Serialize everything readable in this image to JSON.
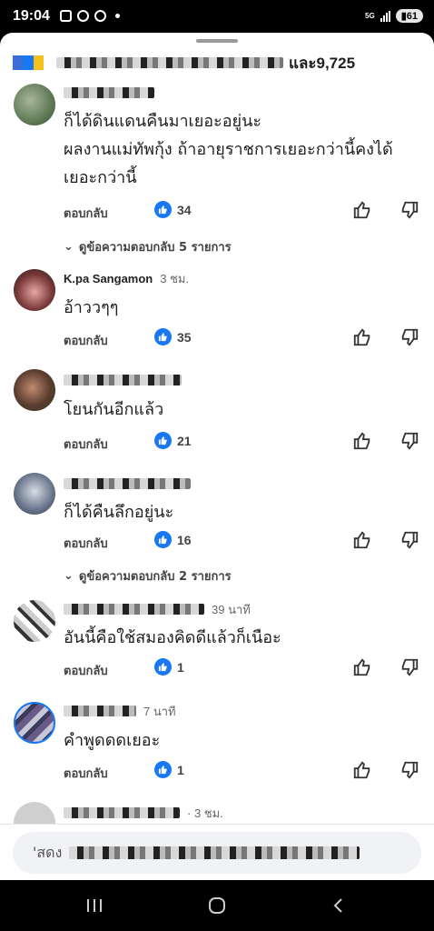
{
  "status": {
    "time": "19:04",
    "network": "5G",
    "battery": "61"
  },
  "reactions": {
    "summary_suffix": "และ9,725"
  },
  "labels": {
    "reply": "ตอบกลับ"
  },
  "comments": [
    {
      "time": "",
      "text": "ก็ได้ดินแดนคืนมาเยอะอยู่นะ\nผลงานแม่ทัพกุ้ง ถ้าอายุราชการเยอะกว่านี้คงได้\nเยอะกว่านี้",
      "likes": "34",
      "view_replies": "ดูข้อความตอบกลับ 5 รายการ"
    },
    {
      "name": "K.pa Sangamon",
      "time": "3 ชม.",
      "text": "อ้าววๆๆ",
      "likes": "35"
    },
    {
      "time": "",
      "text": "โยนกันอีกแล้ว",
      "likes": "21"
    },
    {
      "time": "",
      "text": "ก็ได้คืนลึกอยู่นะ",
      "likes": "16",
      "view_replies": "ดูข้อความตอบกลับ 2 รายการ"
    },
    {
      "time": "39 นาที",
      "text": "อันนี้คือใช้สมองคิดดีแล้วก็เนือะ",
      "likes": "1"
    },
    {
      "time": "7 นาที",
      "text": "คำพูดดดเยอะ",
      "likes": "1"
    },
    {
      "time": "· 3 ชม.",
      "text": "",
      "likes": ""
    }
  ],
  "input": {
    "placeholder": "'สดง"
  },
  "colors": {
    "like_blue": "#1877f2",
    "text": "#1c1e21",
    "muted": "#65676b"
  }
}
